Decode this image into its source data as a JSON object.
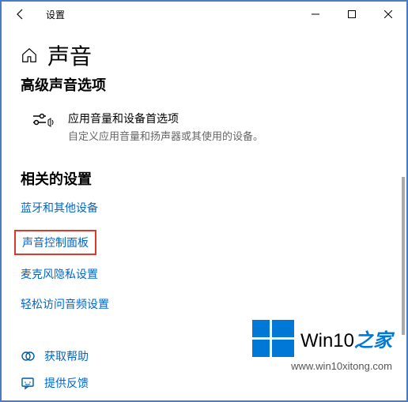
{
  "titlebar": {
    "title": "设置"
  },
  "page": {
    "title": "声音",
    "advanced_section": "高级声音选项"
  },
  "option": {
    "title": "应用音量和设备首选项",
    "desc": "自定义应用音量和扬声器或其使用的设备。"
  },
  "related": {
    "heading": "相关的设置",
    "links": {
      "bluetooth": "蓝牙和其他设备",
      "sound_cp": "声音控制面板",
      "mic_privacy": "麦克风隐私设置",
      "ease_audio": "轻松访问音频设置"
    }
  },
  "help": {
    "get_help": "获取帮助",
    "feedback": "提供反馈"
  },
  "watermark": {
    "brand_en": "Win10",
    "brand_zh": "之家",
    "url": "www.win10xitong.com"
  }
}
